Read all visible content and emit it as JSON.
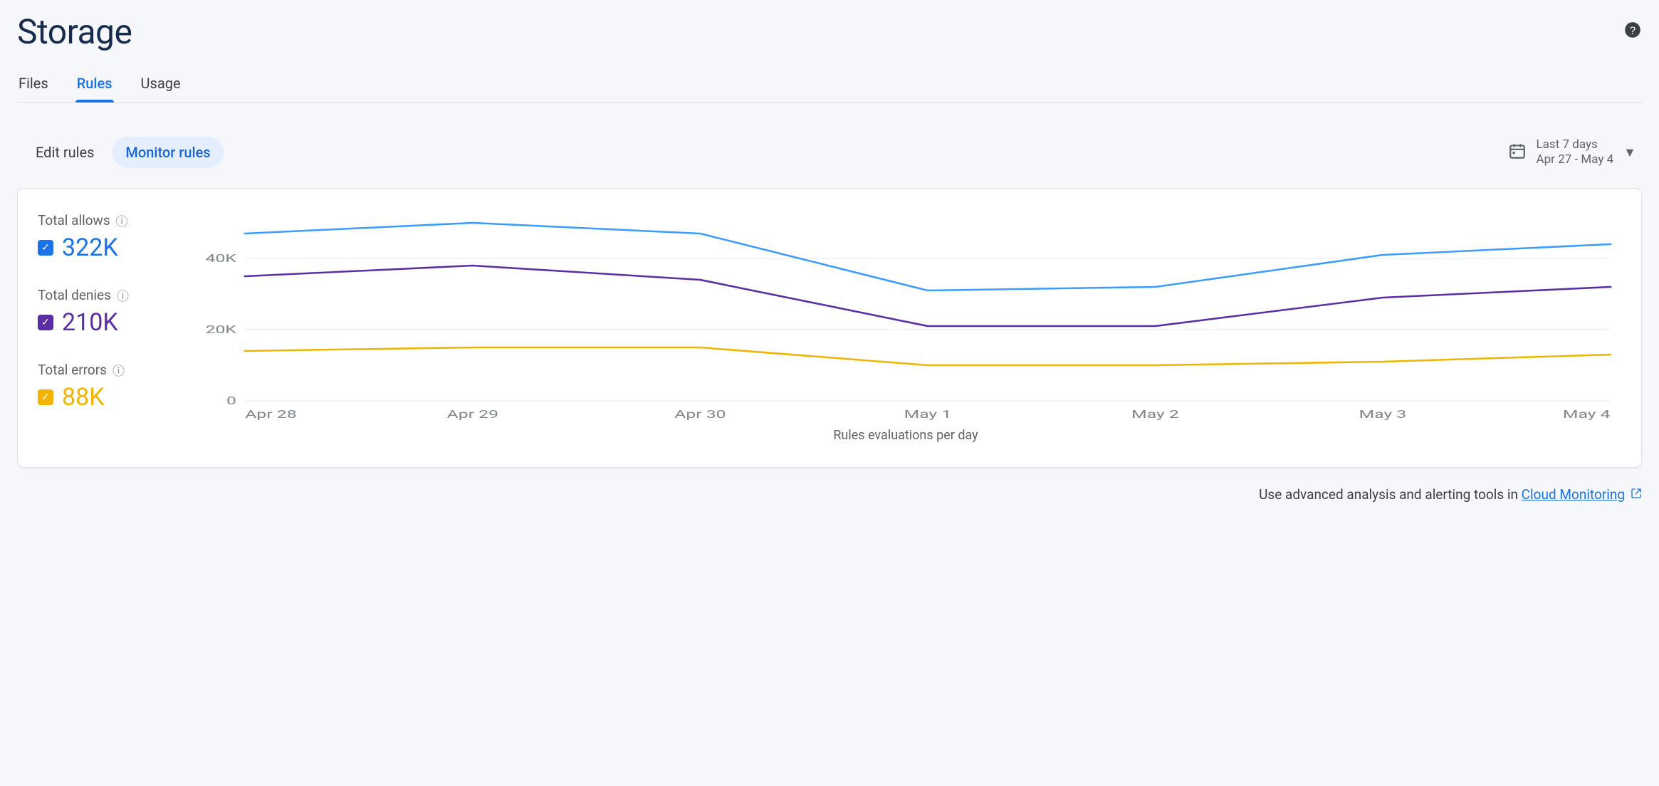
{
  "page": {
    "title": "Storage"
  },
  "tabs": [
    {
      "id": "files",
      "label": "Files"
    },
    {
      "id": "rules",
      "label": "Rules",
      "active": true
    },
    {
      "id": "usage",
      "label": "Usage"
    }
  ],
  "subtabs": {
    "edit": "Edit rules",
    "monitor": "Monitor rules"
  },
  "date_picker": {
    "range_label": "Last 7 days",
    "range_dates": "Apr 27 - May 4"
  },
  "legend": {
    "allows": {
      "label": "Total allows",
      "value": "322K",
      "color": "#1a73e8"
    },
    "denies": {
      "label": "Total denies",
      "value": "210K",
      "color": "#5b2ea6"
    },
    "errors": {
      "label": "Total errors",
      "value": "88K",
      "color": "#f2b400"
    }
  },
  "chart_data": {
    "type": "line",
    "xlabel": "Rules evaluations per day",
    "ylabel": "",
    "ylim": [
      0,
      52000
    ],
    "y_ticks": [
      0,
      20000,
      40000
    ],
    "y_tick_labels": [
      "0",
      "20K",
      "40K"
    ],
    "categories": [
      "Apr 28",
      "Apr 29",
      "Apr 30",
      "May 1",
      "May 2",
      "May 3",
      "May 4"
    ],
    "series": [
      {
        "name": "Total allows",
        "color": "#3b9cff",
        "values": [
          47000,
          50000,
          47000,
          31000,
          32000,
          41000,
          44000
        ]
      },
      {
        "name": "Total denies",
        "color": "#5b2ea6",
        "values": [
          35000,
          38000,
          34000,
          21000,
          21000,
          29000,
          32000
        ]
      },
      {
        "name": "Total errors",
        "color": "#f2b400",
        "values": [
          14000,
          15000,
          15000,
          10000,
          10000,
          11000,
          13000
        ]
      }
    ]
  },
  "footer": {
    "text_prefix": "Use advanced analysis and alerting tools in ",
    "link_text": "Cloud Monitoring"
  }
}
